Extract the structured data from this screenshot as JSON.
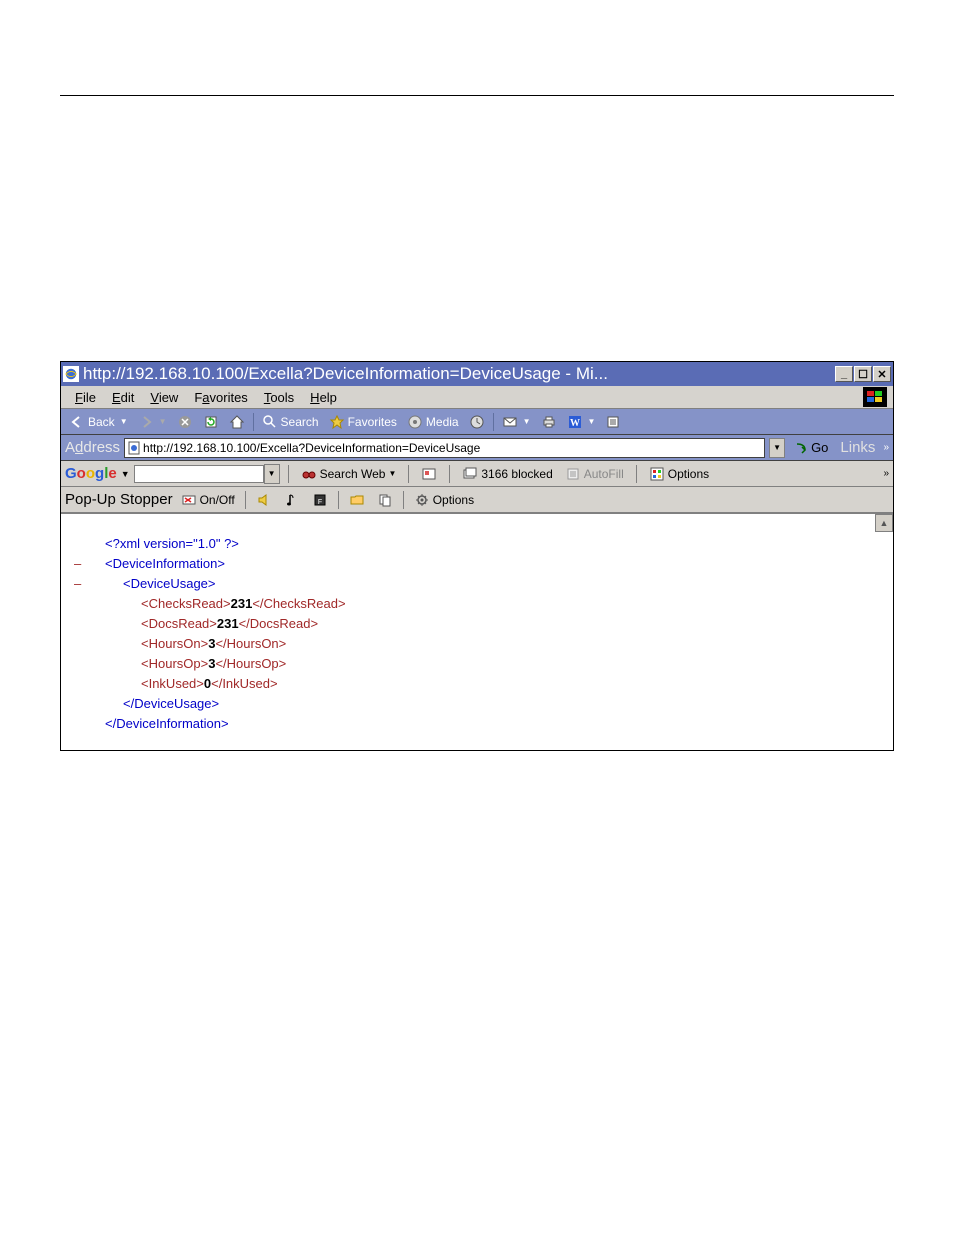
{
  "window": {
    "title": "http://192.168.10.100/Excella?DeviceInformation=DeviceUsage - Mi..."
  },
  "menubar": {
    "file": "File",
    "edit": "Edit",
    "view": "View",
    "favorites": "Favorites",
    "tools": "Tools",
    "help": "Help"
  },
  "toolbar": {
    "back": "Back",
    "search": "Search",
    "favorites": "Favorites",
    "media": "Media"
  },
  "addressbar": {
    "label": "Address",
    "url": "http://192.168.10.100/Excella?DeviceInformation=DeviceUsage",
    "go": "Go",
    "links": "Links"
  },
  "googlebar": {
    "search_web": "Search Web",
    "blocked": "3166 blocked",
    "autofill": "AutoFill",
    "options": "Options"
  },
  "popupbar": {
    "label": "Pop-Up Stopper",
    "onoff": "On/Off",
    "options": "Options"
  },
  "xml": {
    "decl": "<?xml version=\"1.0\" ?>",
    "root_open": "<DeviceInformation>",
    "root_close": "</DeviceInformation>",
    "child_open": "<DeviceUsage>",
    "child_close": "</DeviceUsage>",
    "checks_read_open": "<ChecksRead>",
    "checks_read_val": "231",
    "checks_read_close": "</ChecksRead>",
    "docs_read_open": "<DocsRead>",
    "docs_read_val": "231",
    "docs_read_close": "</DocsRead>",
    "hours_on_open": "<HoursOn>",
    "hours_on_val": "3",
    "hours_on_close": "</HoursOn>",
    "hours_op_open": "<HoursOp>",
    "hours_op_val": "3",
    "hours_op_close": "</HoursOp>",
    "ink_used_open": "<InkUsed>",
    "ink_used_val": "0",
    "ink_used_close": "</InkUsed>"
  }
}
